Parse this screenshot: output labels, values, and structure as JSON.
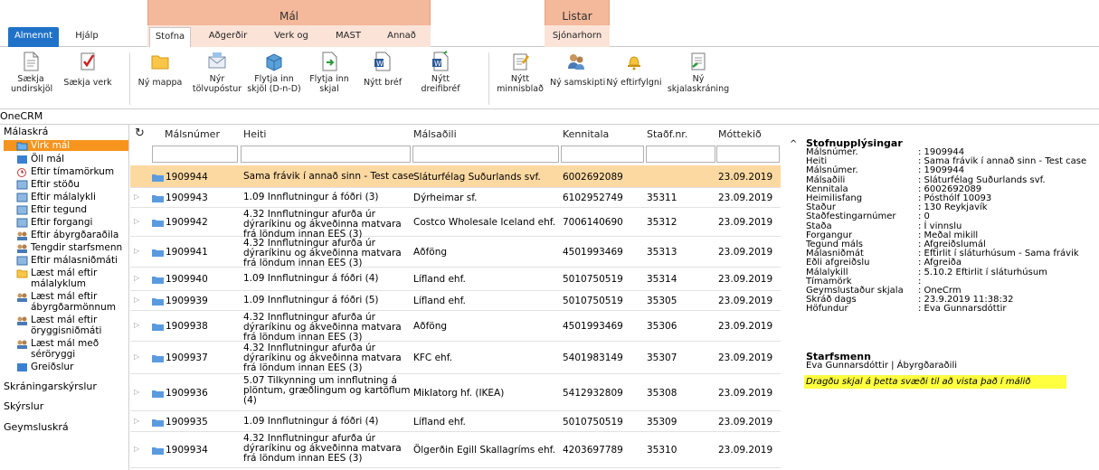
{
  "top_groups": {
    "mal": "Mál",
    "listar": "Listar"
  },
  "tabs": [
    {
      "label": "Almennt"
    },
    {
      "label": "Hjálp"
    },
    {
      "label": "Stofna"
    },
    {
      "label": "Aðgerðir"
    },
    {
      "label": "Verk og fasar"
    },
    {
      "label": "MAST"
    },
    {
      "label": "Annað"
    },
    {
      "label": "Sjónarhorn"
    }
  ],
  "ribbon": [
    {
      "label1": "Sækja",
      "label2": "undirskjöl",
      "icon": "document-icon"
    },
    {
      "label1": "Sækja verk",
      "label2": "",
      "icon": "checklist-icon"
    },
    {
      "label1": "Ný mappa",
      "label2": "",
      "icon": "folder-icon"
    },
    {
      "label1": "Nýr",
      "label2": "tölvupóstur",
      "icon": "envelope-icon"
    },
    {
      "label1": "Flytja inn",
      "label2": "skjöl (D-n-D)",
      "icon": "box-icon"
    },
    {
      "label1": "Flytja inn",
      "label2": "skjal",
      "icon": "import-doc-icon"
    },
    {
      "label1": "Nýtt bréf",
      "label2": "",
      "icon": "word-icon"
    },
    {
      "label1": "Nýtt",
      "label2": "dreifibréf",
      "icon": "word-merge-icon"
    },
    {
      "label1": "Nýtt",
      "label2": "minnisblað",
      "icon": "memo-icon"
    },
    {
      "label1": "Ný samskipti",
      "label2": "",
      "icon": "people-icon"
    },
    {
      "label1": "Ný eftirfylgni",
      "label2": "",
      "icon": "bell-icon"
    },
    {
      "label1": "Ný",
      "label2": "skjalaskráning",
      "icon": "register-icon"
    }
  ],
  "crm_label": "OneCRM",
  "sidebar": {
    "head": "Málaskrá",
    "items": [
      {
        "label": "Virk mál"
      },
      {
        "label": "Öll mál"
      },
      {
        "label": "Eftir tímamörkum"
      },
      {
        "label": "Eftir stöðu"
      },
      {
        "label": "Eftir málalykli"
      },
      {
        "label": "Eftir tegund"
      },
      {
        "label": "Eftir forgangi"
      },
      {
        "label": "Eftir ábyrgðaraðila"
      },
      {
        "label": "Tengdir starfsmenn"
      },
      {
        "label": "Eftir málasniðmáti"
      },
      {
        "label": "Læst mál eftir málalyklum"
      },
      {
        "label": "Læst mál eftir ábyrgðarmönnum"
      },
      {
        "label": "Læst mál eftir öryggisniðmáti"
      },
      {
        "label": "Læst mál með séröryggi"
      },
      {
        "label": "Greiðslur"
      }
    ],
    "sections": [
      "Skráningarskýrslur",
      "Skýrslur",
      "Geymsluskrá"
    ]
  },
  "grid": {
    "headers": [
      "Málsnúmer",
      "Heiti",
      "Málsaðili",
      "Kennitala",
      "Staðf.nr.",
      "Móttekið"
    ],
    "rows": [
      {
        "nr": "1909944",
        "heiti": "Sama frávik í annað sinn - Test case",
        "aðili": "Sláturfélag Suðurlands svf.",
        "kt": "6002692089",
        "stadf": "",
        "dags": "23.09.2019"
      },
      {
        "nr": "1909943",
        "heiti": "1.09 Innflutningur á fóðri (3)",
        "aðili": "Dýrheimar sf.",
        "kt": "6102952749",
        "stadf": "35311",
        "dags": "23.09.2019"
      },
      {
        "nr": "1909942",
        "heiti": "4.32 Innflutningur afurða úr dýraríkinu og ákveðinna matvara frá löndum innan EES (3)",
        "aðili": "Costco Wholesale Iceland ehf.",
        "kt": "7006140690",
        "stadf": "35312",
        "dags": "23.09.2019"
      },
      {
        "nr": "1909941",
        "heiti": "4.32 Innflutningur afurða úr dýraríkinu og ákveðinna matvara frá löndum innan EES (3)",
        "aðili": "Aðföng",
        "kt": "4501993469",
        "stadf": "35313",
        "dags": "23.09.2019"
      },
      {
        "nr": "1909940",
        "heiti": "1.09 Innflutningur á fóðri (4)",
        "aðili": "Lífland ehf.",
        "kt": "5010750519",
        "stadf": "35314",
        "dags": "23.09.2019"
      },
      {
        "nr": "1909939",
        "heiti": "1.09 Innflutningur á fóðri (5)",
        "aðili": "Lífland ehf.",
        "kt": "5010750519",
        "stadf": "35305",
        "dags": "23.09.2019"
      },
      {
        "nr": "1909938",
        "heiti": "4.32 Innflutningur afurða úr dýraríkinu og ákveðinna matvara frá löndum innan EES (3)",
        "aðili": "Aðföng",
        "kt": "4501993469",
        "stadf": "35306",
        "dags": "23.09.2019"
      },
      {
        "nr": "1909937",
        "heiti": "4.32 Innflutningur afurða úr dýraríkinu og ákveðinna matvara frá löndum innan EES (3)",
        "aðili": "KFC ehf.",
        "kt": "5401983149",
        "stadf": "35307",
        "dags": "23.09.2019"
      },
      {
        "nr": "1909936",
        "heiti": "5.07 Tilkynning um innflutning á plöntum, græðlingum og kartöflum (4)",
        "aðili": "Miklatorg hf. (IKEA)",
        "kt": "5412932809",
        "stadf": "35308",
        "dags": "23.09.2019"
      },
      {
        "nr": "1909935",
        "heiti": "1.09 Innflutningur á fóðri (4)",
        "aðili": "Lífland ehf.",
        "kt": "5010750519",
        "stadf": "35309",
        "dags": "23.09.2019"
      },
      {
        "nr": "1909934",
        "heiti": "4.32 Innflutningur afurða úr dýraríkinu og ákveðinna matvara frá löndum innan EES (3)",
        "aðili": "Ölgerðin Egill Skallagríms ehf.",
        "kt": "4203697789",
        "stadf": "35310",
        "dags": "23.09.2019"
      }
    ]
  },
  "details": {
    "title": "Stofnupplýsingar",
    "fields": [
      {
        "k": "Málsnúmer.",
        "v": ": 1909944"
      },
      {
        "k": "Heiti",
        "v": ": Sama frávik í annað sinn - Test case"
      },
      {
        "k": "Málsnúmer.",
        "v": ": 1909944"
      },
      {
        "k": "Málsaðili",
        "v": ": Sláturfélag Suðurlands svf."
      },
      {
        "k": "Kennitala",
        "v": ": 6002692089"
      },
      {
        "k": "Heimilisfang",
        "v": ": Pósthólf 10093"
      },
      {
        "k": "Staður",
        "v": ": 130 Reykjavík"
      },
      {
        "k": "Staðfestingarnúmer",
        "v": ": 0"
      },
      {
        "k": "Staða",
        "v": ": Í vinnslu"
      },
      {
        "k": "Forgangur",
        "v": ": Meðal mikill"
      },
      {
        "k": "Tegund máls",
        "v": ": Afgreiðslumál"
      },
      {
        "k": "Málasniðmát",
        "v": ": Eftirlit í sláturhúsum - Sama frávik"
      },
      {
        "k": "Eðli afgreiðslu",
        "v": ": Afgreiða"
      },
      {
        "k": "Málalykill",
        "v": ": 5.10.2 Eftirlit í sláturhúsum"
      },
      {
        "k": "Tímamörk",
        "v": ":"
      },
      {
        "k": "Geymslustaður skjala",
        "v": ": OneCrm"
      },
      {
        "k": "Skráð dags",
        "v": ": 23.9.2019 11:38:32"
      },
      {
        "k": "Höfundur",
        "v": ": Eva Gunnarsdóttir"
      }
    ],
    "staff_title": "Starfsmenn",
    "staff_line": "Eva Gunnarsdóttir | Ábyrgðaraðili",
    "drop_hint": "Dragðu skjal á þetta svæði til að vista það í málið"
  },
  "colors": {
    "accent_orange": "#f7941e",
    "tab_blue": "#1f72c8",
    "group_salmon": "#f4b89a",
    "highlight_row": "#fdd9a2",
    "hint_yellow": "#ffff40"
  }
}
